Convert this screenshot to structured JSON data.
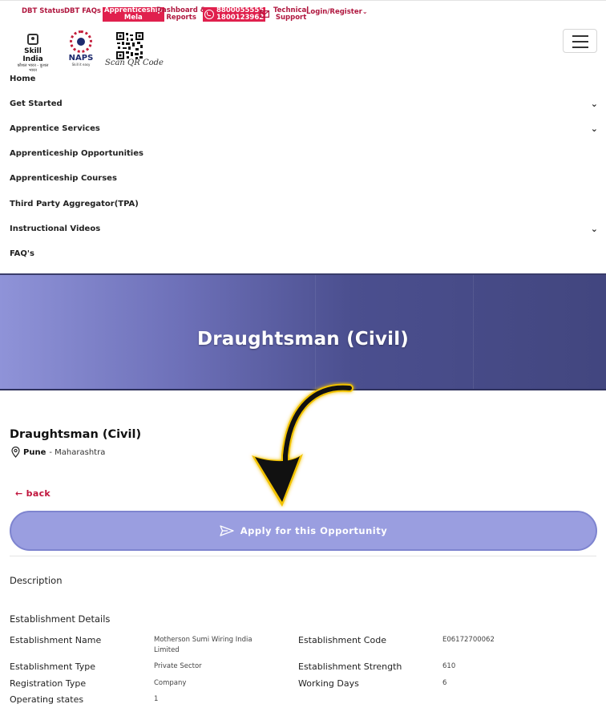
{
  "topbar": {
    "dbt_status": "DBT Status",
    "dbt_faqs": "DBT FAQs",
    "apprenticeship_mela_l1": "Apprenticeship",
    "apprenticeship_mela_l2": "Mela",
    "dashboard_l1": "Dashboard &",
    "dashboard_l2": "Reports",
    "phone_1": "8800055555",
    "phone_2": "1800123962",
    "tech_support_l1": "Technical",
    "tech_support_l2": "Support",
    "login": "Login/Register"
  },
  "logos": {
    "skill_india_l1": "Skill India",
    "skill_india_l2": "कौशल भारत - कुशल भारत",
    "naps": "NAPS",
    "naps_sub": "Skill it easy",
    "qr_label": "Scan QR Code"
  },
  "nav": {
    "items": [
      {
        "label": "Home",
        "has_chevron": false
      },
      {
        "label": "Get Started",
        "has_chevron": true
      },
      {
        "label": "Apprentice Services",
        "has_chevron": true
      },
      {
        "label": "Apprenticeship Opportunities",
        "has_chevron": false
      },
      {
        "label": "Apprenticeship Courses",
        "has_chevron": false
      },
      {
        "label": "Third Party Aggregator(TPA)",
        "has_chevron": false
      },
      {
        "label": "Instructional Videos",
        "has_chevron": true
      },
      {
        "label": "FAQ's",
        "has_chevron": false
      }
    ]
  },
  "banner": {
    "title": "Draughtsman (Civil)"
  },
  "job": {
    "title": "Draughtsman (Civil)",
    "city": "Pune",
    "state": "- Maharashtra",
    "back_label": "back",
    "apply_label": "Apply for this Opportunity"
  },
  "sections": {
    "description": "Description",
    "establishment_details": "Establishment Details"
  },
  "establishment": {
    "name_label": "Establishment Name",
    "name_value_l1": "Motherson Sumi Wiring India",
    "name_value_l2": "Limited",
    "code_label": "Establishment Code",
    "code_value": "E06172700062",
    "type_label": "Establishment Type",
    "type_value": "Private Sector",
    "strength_label": "Establishment Strength",
    "strength_value": "610",
    "reg_type_label": "Registration Type",
    "reg_type_value": "Company",
    "working_days_label": "Working Days",
    "working_days_value": "6",
    "operating_states_label": "Operating states",
    "operating_states_value": "1"
  },
  "colors": {
    "brand_red": "#e0204d",
    "link_red": "#c0143c",
    "banner_start": "#8f93d8",
    "banner_end": "#42467f",
    "apply_button": "#9a9ee0",
    "arrow_glow": "#f2c200"
  },
  "icons": {
    "phone": "phone-icon",
    "mail": "mail-icon",
    "location": "map-pin-icon",
    "back": "arrow-left-icon",
    "send": "paper-plane-icon",
    "menu": "hamburger-menu-icon",
    "chevron": "chevron-down-icon"
  }
}
